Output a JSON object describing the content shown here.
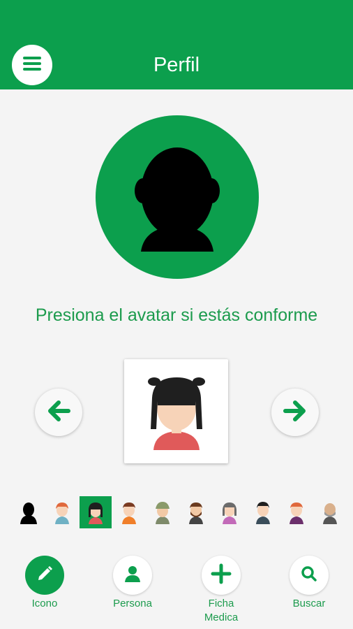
{
  "header": {
    "title": "Perfil",
    "menu_icon": "hamburger-menu-icon",
    "background_color": "#0c9f4d"
  },
  "main": {
    "current_avatar_icon": "default-silhouette-avatar",
    "prompt": "Presiona el avatar si estás conforme",
    "preview_avatar_icon": "girl-black-hair-avatar",
    "left_arrow_icon": "arrow-left-icon",
    "right_arrow_icon": "arrow-right-icon",
    "accent_color": "#1c9b4d"
  },
  "avatar_strip": {
    "selected_index": 2,
    "items": [
      "silhouette-avatar",
      "boy-orange-hair-avatar",
      "girl-black-hair-avatar",
      "man-brown-hair-avatar",
      "man-olive-hat-avatar",
      "man-beard-avatar",
      "woman-purple-avatar",
      "man-black-hair-avatar",
      "boy-purple-shirt-avatar",
      "bald-man-avatar"
    ]
  },
  "bottom_nav": {
    "items": [
      {
        "label": "Icono",
        "icon": "pencil-icon",
        "active": true
      },
      {
        "label": "Persona",
        "icon": "person-icon",
        "active": false
      },
      {
        "label": "Ficha Medica",
        "icon": "plus-icon",
        "active": false
      },
      {
        "label": "Buscar",
        "icon": "search-icon",
        "active": false
      }
    ]
  }
}
